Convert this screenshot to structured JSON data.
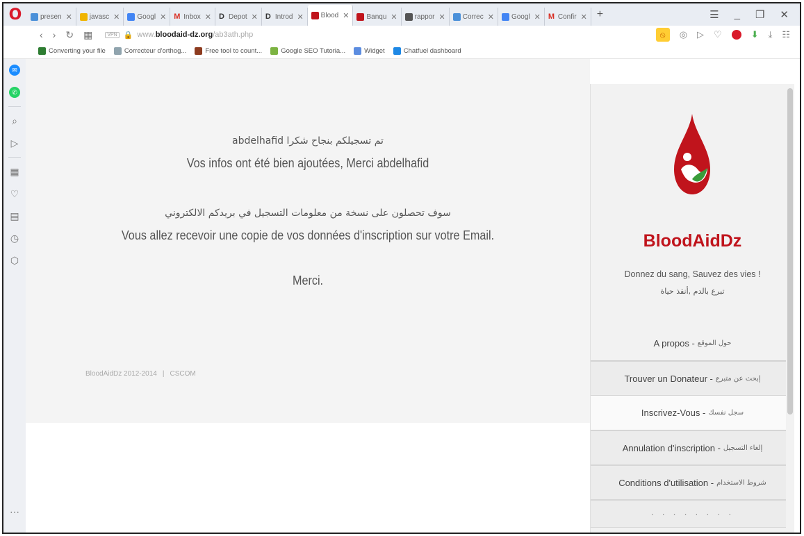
{
  "tabs": [
    {
      "label": "presen",
      "color": "#4a90d9"
    },
    {
      "label": "javasc",
      "color": "#f0b400"
    },
    {
      "label": "Googl",
      "color": "#4285f4"
    },
    {
      "label": "Inbox",
      "color": "#d93025",
      "mark": "M"
    },
    {
      "label": "Depot",
      "color": "#333333",
      "mark": "D"
    },
    {
      "label": "Introd",
      "color": "#333333",
      "mark": "D"
    },
    {
      "label": "Blood",
      "color": "#c0141c",
      "active": true
    },
    {
      "label": "Banqu",
      "color": "#c0141c"
    },
    {
      "label": "rappor",
      "color": "#555555"
    },
    {
      "label": "Correc",
      "color": "#4a90d9"
    },
    {
      "label": "Googl",
      "color": "#4285f4"
    },
    {
      "label": "Confir",
      "color": "#d93025",
      "mark": "M"
    }
  ],
  "address": {
    "vpn": "VPN",
    "prefix": "www.",
    "host": "bloodaid-dz.org",
    "path": "/ab3ath.php"
  },
  "bookmarks": [
    {
      "label": "Converting your file",
      "color": "#2e7d32"
    },
    {
      "label": "Correcteur d'orthog...",
      "color": "#90a4ae"
    },
    {
      "label": "Free tool to count...",
      "color": "#8d3b1f"
    },
    {
      "label": "Google SEO Tutoria...",
      "color": "#7cb342"
    },
    {
      "label": "Widget",
      "color": "#5c8de0"
    },
    {
      "label": "Chatfuel dashboard",
      "color": "#1e88e5"
    }
  ],
  "message": {
    "line1_ar": "تم تسجيلكم بنجاح شكرا abdelhafid",
    "line1_fr": "Vos infos ont été bien ajoutées, Merci abdelhafid",
    "line2_ar": "سوف تحصلون على نسخة من معلومات التسجيل في بريدكم الالكتروني",
    "line2_fr": "Vous allez recevoir une copie de vos données d'inscription sur votre Email.",
    "thanks": "Merci."
  },
  "footer": {
    "copyright": "BloodAidDz 2012-2014",
    "separator": "|",
    "company": "CSCOM"
  },
  "brand": {
    "name": "BloodAidDz",
    "tagline_fr": "Donnez du sang, Sauvez des vies !",
    "tagline_ar": "تبرع بالدم ,أنقذ حياة",
    "color": "#c0141c"
  },
  "menu": [
    {
      "fr": "A propos -",
      "ar": "حول الموقع"
    },
    {
      "fr": "Trouver un Donateur -",
      "ar": "إبحث عن متبرع"
    },
    {
      "fr": "Inscrivez-Vous -",
      "ar": "سجل نفسك"
    },
    {
      "fr": "Annulation d'inscription -",
      "ar": "إلغاء التسجيل"
    },
    {
      "fr": "Conditions d'utilisation -",
      "ar": "شروط الاستخدام"
    }
  ]
}
